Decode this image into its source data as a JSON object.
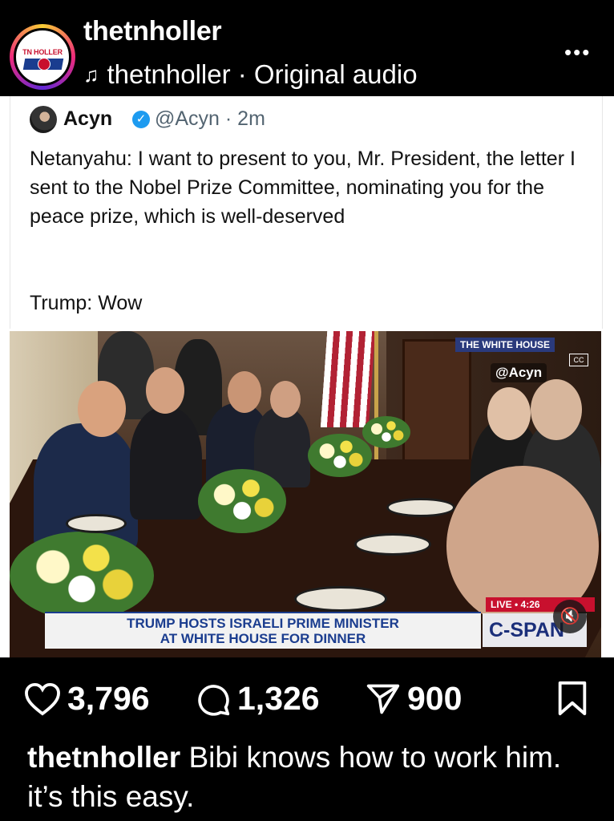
{
  "header": {
    "username": "thetnholler",
    "avatar_text": "TN HOLLER",
    "audio_label": "thetnholler · Original audio",
    "more_icon": "more-horizontal-icon"
  },
  "tweet": {
    "name": "Acyn",
    "handle_time": "@Acyn · 2m",
    "text": "Netanyahu: I want to present to you, Mr. President, the letter I sent to the Nobel Prize Committee, nominating you for the peace prize, which is well-deserved",
    "text2": "Trump: Wow"
  },
  "video": {
    "network_badge": "THE WHITE HOUSE",
    "watermark": "@Acyn",
    "lower_third_line1": "TRUMP HOSTS ISRAELI PRIME MINISTER",
    "lower_third_line2": "AT WHITE HOUSE FOR DINNER",
    "live_label": "LIVE • 4:26",
    "network": "C-SPAN",
    "mute_icon": "muted-speaker-icon"
  },
  "actions": {
    "likes": "3,796",
    "comments": "1,326",
    "shares": "900"
  },
  "caption": {
    "username": "thetnholler",
    "text": "Bibi knows how to work him. it’s this easy."
  }
}
